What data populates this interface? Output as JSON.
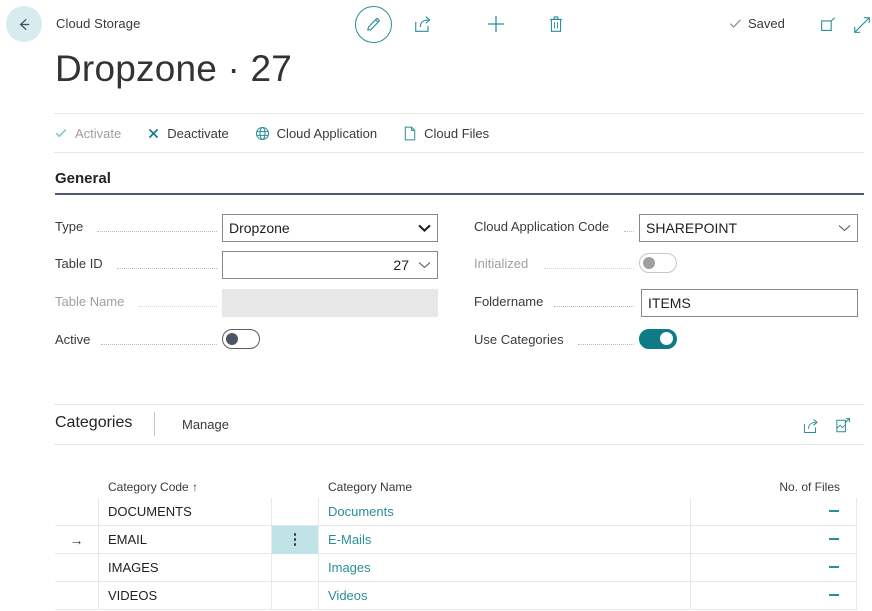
{
  "header": {
    "back_icon": "back-arrow-icon",
    "breadcrumb": "Cloud Storage",
    "edit_icon": "pencil-icon",
    "share_icon": "share-icon",
    "new_icon": "plus-icon",
    "delete_icon": "trash-icon",
    "saved_label": "Saved",
    "saved_check_icon": "check-icon",
    "open_new_window_icon": "open-in-new-window-icon",
    "expand_icon": "expand-diagonal-icon"
  },
  "page": {
    "title": "Dropzone · 27"
  },
  "actions": [
    {
      "label": "Activate",
      "icon": "check-icon",
      "disabled": true
    },
    {
      "label": "Deactivate",
      "icon": "x-icon",
      "disabled": false
    },
    {
      "label": "Cloud Application",
      "icon": "globe-icon",
      "disabled": false
    },
    {
      "label": "Cloud Files",
      "icon": "file-icon",
      "disabled": false
    }
  ],
  "general": {
    "title": "General",
    "fields": {
      "type": {
        "label": "Type",
        "value": "Dropzone",
        "control": "dropdown"
      },
      "table_id": {
        "label": "Table ID",
        "value": "27",
        "control": "lookup"
      },
      "table_name": {
        "label": "Table Name",
        "value": "",
        "control": "readonly"
      },
      "active": {
        "label": "Active",
        "value": "off",
        "control": "toggle"
      },
      "cloud_app": {
        "label": "Cloud Application Code",
        "value": "SHAREPOINT",
        "control": "lookup"
      },
      "initialized": {
        "label": "Initialized",
        "value": "off",
        "control": "toggle"
      },
      "foldername": {
        "label": "Foldername",
        "value": "ITEMS",
        "control": "text"
      },
      "use_cats": {
        "label": "Use Categories",
        "value": "on",
        "control": "toggle"
      }
    }
  },
  "categories_part": {
    "title": "Categories",
    "manage_label": "Manage",
    "share_icon": "share-icon",
    "open_excel_icon": "open-in-excel-icon",
    "columns": [
      "",
      "Category Code ↑",
      "",
      "Category Name",
      "No. of Files"
    ],
    "rows": [
      {
        "selected": false,
        "code": "DOCUMENTS",
        "name": "Documents",
        "files": "-"
      },
      {
        "selected": true,
        "code": "EMAIL",
        "name": "E-Mails",
        "files": "-"
      },
      {
        "selected": false,
        "code": "IMAGES",
        "name": "Images",
        "files": "-"
      },
      {
        "selected": false,
        "code": "VIDEOS",
        "name": "Videos",
        "files": "-"
      }
    ]
  },
  "colors": {
    "accent_teal": "#2a8f99",
    "toggle_on": "#0e7c86",
    "back_circle": "#d6ecef",
    "selected_cell": "#bfe3e7",
    "section_rule": "#4b5a72"
  }
}
